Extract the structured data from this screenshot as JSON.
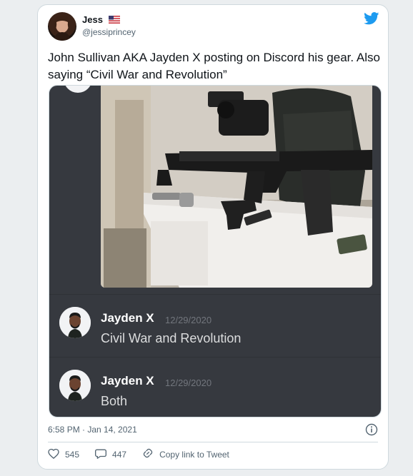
{
  "author": {
    "display_name": "Jess",
    "handle": "@jessiprincey"
  },
  "tweet": {
    "text": "John Sullivan AKA Jayden X posting on Discord his gear. Also saying “Civil War and Revolution”",
    "timestamp": "6:58 PM · Jan 14, 2021"
  },
  "discord": {
    "messages": [
      {
        "author": "Jayden X",
        "date": "12/29/2020",
        "text": "Civil War and Revolution"
      },
      {
        "author": "Jayden X",
        "date": "12/29/2020",
        "text": "Both"
      }
    ]
  },
  "actions": {
    "likes": "545",
    "replies": "447",
    "copy_link": "Copy link to Tweet"
  },
  "colors": {
    "twitter_blue": "#1d9bf0",
    "discord_bg": "#36393f",
    "text_primary": "#0f1419",
    "text_secondary": "#536471"
  },
  "icons": [
    "twitter-bird-icon",
    "us-flag-icon",
    "info-icon",
    "heart-icon",
    "reply-icon",
    "link-icon"
  ]
}
